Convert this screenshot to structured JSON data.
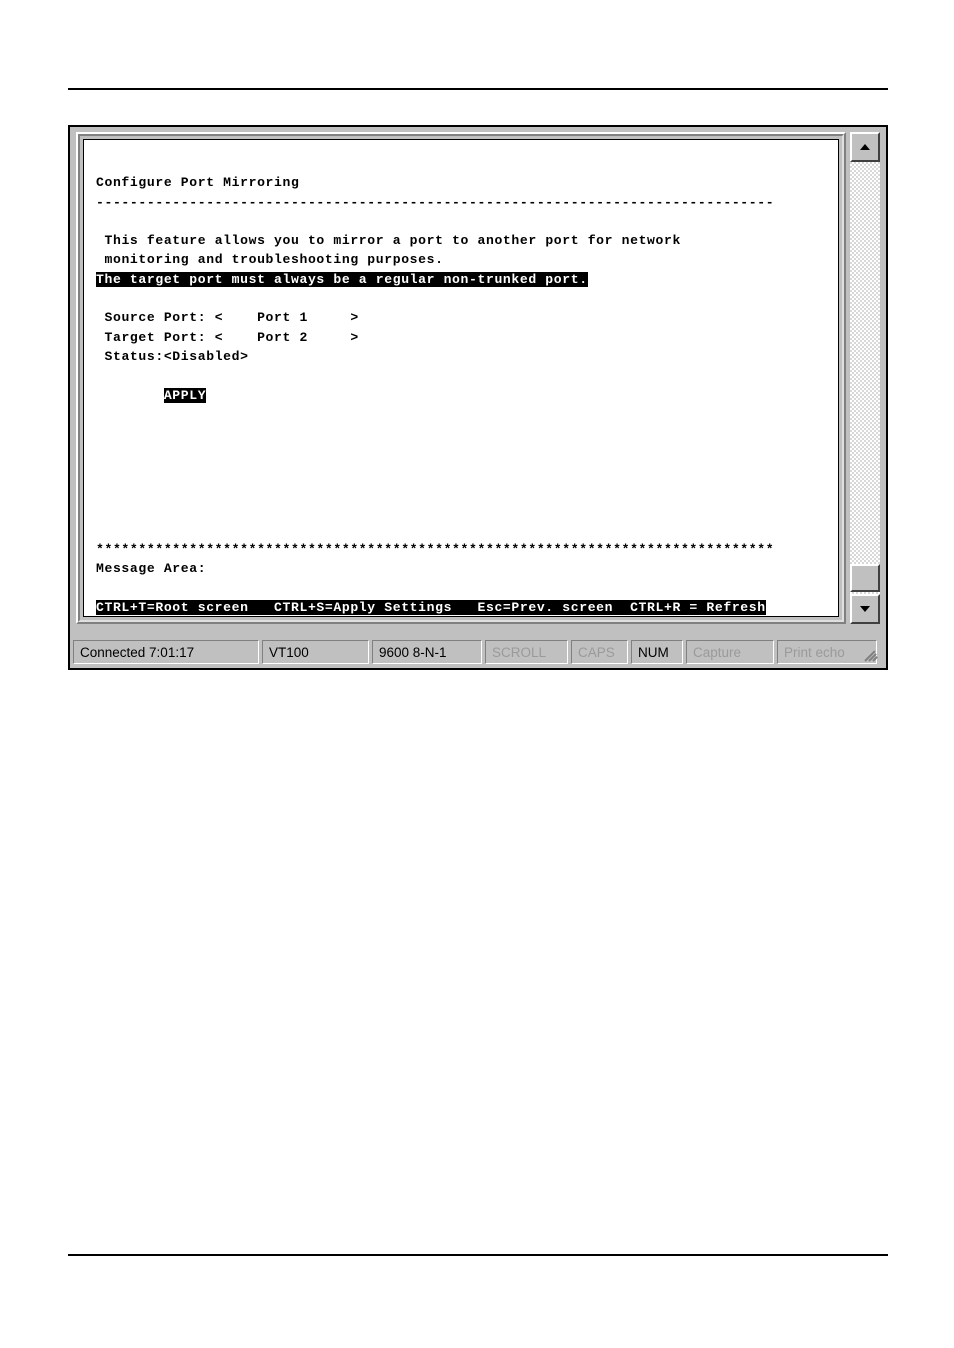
{
  "page": {
    "rules": [
      "top-horizontal-rule",
      "bottom-horizontal-rule"
    ]
  },
  "terminal": {
    "title": "Configure Port Mirroring",
    "separator": "--------------------------------------------------------------------------------",
    "description_line_1": "This feature allows you to mirror a port to another port for network",
    "description_line_2": "monitoring and troubleshooting purposes.",
    "highlighted_note": "The target port must always be a regular non-trunked port.",
    "fields": {
      "source_port_label": "Source Port:",
      "source_port_value": "<    Port 1     >",
      "source_port_line": "Source Port: <    Port 1     >",
      "target_port_label": "Target Port:",
      "target_port_value": "<    Port 2     >",
      "target_port_line": "Target Port: <    Port 2     >",
      "status_label": "Status:",
      "status_value": "<Disabled>",
      "status_line": "Status:<Disabled>"
    },
    "apply_button": "APPLY",
    "asterisk_rule": "********************************************************************************",
    "message_area_label": "Message Area:",
    "key_help_bar": "CTRL+T=Root screen   CTRL+S=Apply Settings   Esc=Prev. screen  CTRL+R = Refresh",
    "key_help_items": [
      "CTRL+T=Root screen",
      "CTRL+S=Apply Settings",
      "Esc=Prev. screen",
      "CTRL+R = Refresh"
    ],
    "colors": {
      "screen_background": "#ffffff",
      "screen_foreground": "#000000",
      "inverse_background": "#000000",
      "inverse_foreground": "#ffffff",
      "window_chrome": "#c0c0c0"
    }
  },
  "scrollbar": {
    "up_arrow": "scroll-up-arrow",
    "down_arrow": "scroll-down-arrow",
    "thumb": "scroll-thumb",
    "orientation": "vertical"
  },
  "status_bar": {
    "connected": "Connected 7:01:17",
    "emulation": "VT100",
    "line_settings": "9600 8-N-1",
    "scroll_indicator": "SCROLL",
    "caps_indicator": "CAPS",
    "num_indicator": "NUM",
    "capture_indicator": "Capture",
    "print_echo_indicator": "Print echo",
    "resize_grip": "resize-grip"
  }
}
